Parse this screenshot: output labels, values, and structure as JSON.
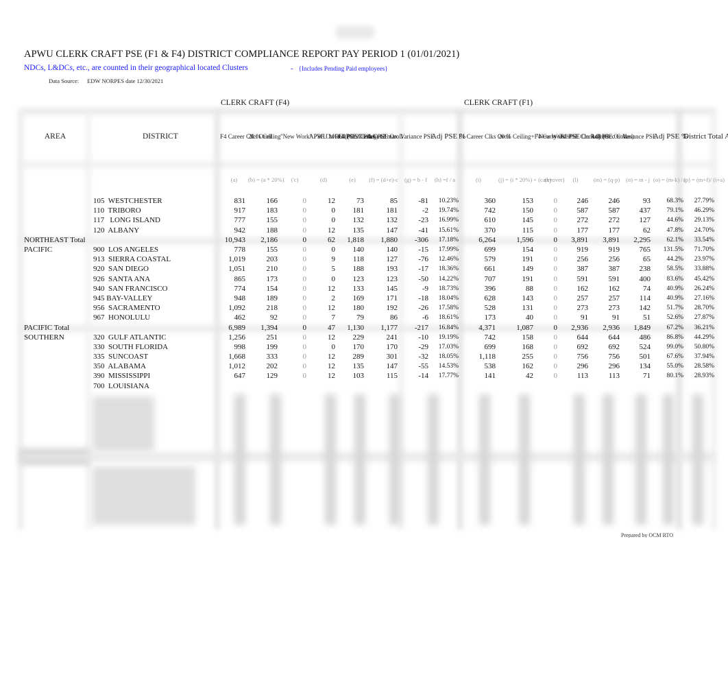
{
  "report": {
    "title": "APWU CLERK CRAFT PSE (F1 & F4) DISTRICT COMPLIANCE REPORT PAY PERIOD 1 (01/01/2021)",
    "subtitle": "NDCs, L&DCs, etc., are counted in their geographical located Clusters",
    "subnote_dash": "-",
    "subnote": "{Includes Pending Paid employees}",
    "data_source_label": "Data Source:",
    "data_source_value": "EDW NORPES date 12/30/2021",
    "prepared_by": "Prepared by OCM RTO"
  },
  "groups": {
    "f4": "CLERK CRAFT (F4)",
    "f1": "CLERK CRAFT (F1)"
  },
  "headers": {
    "area": "AREA",
    "district": "DISTRICT",
    "f4_career": "F4 Career Clks Oroll",
    "f4_ceiling": "20 % Ceiling",
    "f4_new_work": "\"New Work\" PSE On Roll (Occ Codes)",
    "f4_mou": "APWU MOU (POST Plan - 12 max",
    "f4_pse": "F4 PSE Clerk Oroll",
    "f4_adj": "Adj PSE Oroll",
    "f4_var": "Variance PSE",
    "f4_pct": "Adj PSE %",
    "f1_career": "F1 Career Clks Oroll",
    "f1_ceiling": "20 % Ceiling+F4 Carry Over",
    "f1_new_work": "\"New Work\" PSE On Roll (Occ Codes)",
    "f1_pse": "F1 PSE Clerk Oroll",
    "f1_adj": "Adj PSE Oroll",
    "f1_var": "Variance PSE",
    "f1_pct": "Adj PSE %",
    "district_total": "District Total Adj PSE %"
  },
  "formulas": {
    "a": "(a)",
    "b": "(b) = (a * 20%)",
    "c": "('c)",
    "d": "(d)",
    "e": "(e)",
    "f": "(f) = (d+e)-c",
    "g": "(g) = b - f",
    "h": "(h) =f / a",
    "i": "(i)",
    "j": "(j) = (i * 20%) + (carryover)",
    "k": "(k)",
    "l": "(l)",
    "m": "(m) = (q-p)",
    "n": "(n) = m - j",
    "o": "(o) = (m-k) / i",
    "p": "(p) = (m+f)/ (i+a)"
  },
  "rows": [
    {
      "area": "",
      "district": "105  WESTCHESTER",
      "a": "831",
      "b": "166",
      "c": "0",
      "d": "12",
      "e": "73",
      "f": "85",
      "g": "-81",
      "h": "10.23%",
      "i": "360",
      "j": "153",
      "k": "0",
      "l": "246",
      "m": "246",
      "n": "93",
      "o": "68.3%",
      "p": "27.79%",
      "total": false
    },
    {
      "area": "",
      "district": "110  TRIBORO",
      "a": "917",
      "b": "183",
      "c": "0",
      "d": "0",
      "e": "181",
      "f": "181",
      "g": "-2",
      "h": "19.74%",
      "i": "742",
      "j": "150",
      "k": "0",
      "l": "587",
      "m": "587",
      "n": "437",
      "o": "79.1%",
      "p": "46.29%",
      "total": false
    },
    {
      "area": "",
      "district": "117   LONG ISLAND",
      "a": "777",
      "b": "155",
      "c": "0",
      "d": "0",
      "e": "132",
      "f": "132",
      "g": "-23",
      "h": "16.99%",
      "i": "610",
      "j": "145",
      "k": "0",
      "l": "272",
      "m": "272",
      "n": "127",
      "o": "44.6%",
      "p": "29.13%",
      "total": false
    },
    {
      "area": "",
      "district": "120  ALBANY",
      "a": "942",
      "b": "188",
      "c": "0",
      "d": "12",
      "e": "135",
      "f": "147",
      "g": "-41",
      "h": "15.61%",
      "i": "370",
      "j": "115",
      "k": "0",
      "l": "177",
      "m": "177",
      "n": "62",
      "o": "47.8%",
      "p": "24.70%",
      "total": false
    },
    {
      "area": "NORTHEAST Total",
      "district": "",
      "a": "10,943",
      "b": "2,186",
      "c": "0",
      "d": "62",
      "e": "1,818",
      "f": "1,880",
      "g": "-306",
      "h": "17.18%",
      "i": "6,264",
      "j": "1,596",
      "k": "0",
      "l": "3,891",
      "m": "3,891",
      "n": "2,295",
      "o": "62.1%",
      "p": "33.54%",
      "total": true
    },
    {
      "area": "PACIFIC",
      "district": "900  LOS ANGELES",
      "a": "778",
      "b": "155",
      "c": "0",
      "d": "0",
      "e": "140",
      "f": "140",
      "g": "-15",
      "h": "17.99%",
      "i": "699",
      "j": "154",
      "k": "0",
      "l": "919",
      "m": "919",
      "n": "765",
      "o": "131.5%",
      "p": "71.70%",
      "total": false
    },
    {
      "area": "",
      "district": "913  SIERRA COASTAL",
      "a": "1,019",
      "b": "203",
      "c": "0",
      "d": "9",
      "e": "118",
      "f": "127",
      "g": "-76",
      "h": "12.46%",
      "i": "579",
      "j": "191",
      "k": "0",
      "l": "256",
      "m": "256",
      "n": "65",
      "o": "44.2%",
      "p": "23.97%",
      "total": false
    },
    {
      "area": "",
      "district": "920  SAN DIEGO",
      "a": "1,051",
      "b": "210",
      "c": "0",
      "d": "5",
      "e": "188",
      "f": "193",
      "g": "-17",
      "h": "18.36%",
      "i": "661",
      "j": "149",
      "k": "0",
      "l": "387",
      "m": "387",
      "n": "238",
      "o": "58.5%",
      "p": "33.88%",
      "total": false
    },
    {
      "area": "",
      "district": "926  SANTA ANA",
      "a": "865",
      "b": "173",
      "c": "0",
      "d": "0",
      "e": "123",
      "f": "123",
      "g": "-50",
      "h": "14.22%",
      "i": "707",
      "j": "191",
      "k": "0",
      "l": "591",
      "m": "591",
      "n": "400",
      "o": "83.6%",
      "p": "45.42%",
      "total": false
    },
    {
      "area": "",
      "district": "940  SAN FRANCISCO",
      "a": "774",
      "b": "154",
      "c": "0",
      "d": "12",
      "e": "133",
      "f": "145",
      "g": "-9",
      "h": "18.73%",
      "i": "396",
      "j": "88",
      "k": "0",
      "l": "162",
      "m": "162",
      "n": "74",
      "o": "40.9%",
      "p": "26.24%",
      "total": false
    },
    {
      "area": "",
      "district": "945 BAY-VALLEY",
      "a": "948",
      "b": "189",
      "c": "0",
      "d": "2",
      "e": "169",
      "f": "171",
      "g": "-18",
      "h": "18.04%",
      "i": "628",
      "j": "143",
      "k": "0",
      "l": "257",
      "m": "257",
      "n": "114",
      "o": "40.9%",
      "p": "27.16%",
      "total": false
    },
    {
      "area": "",
      "district": "956  SACRAMENTO",
      "a": "1,092",
      "b": "218",
      "c": "0",
      "d": "12",
      "e": "180",
      "f": "192",
      "g": "-26",
      "h": "17.58%",
      "i": "528",
      "j": "131",
      "k": "0",
      "l": "273",
      "m": "273",
      "n": "142",
      "o": "51.7%",
      "p": "28.70%",
      "total": false
    },
    {
      "area": "",
      "district": "967  HONOLULU",
      "a": "462",
      "b": "92",
      "c": "0",
      "d": "7",
      "e": "79",
      "f": "86",
      "g": "-6",
      "h": "18.61%",
      "i": "173",
      "j": "40",
      "k": "0",
      "l": "91",
      "m": "91",
      "n": "51",
      "o": "52.6%",
      "p": "27.87%",
      "total": false
    },
    {
      "area": "PACIFIC Total",
      "district": "",
      "a": "6,989",
      "b": "1,394",
      "c": "0",
      "d": "47",
      "e": "1,130",
      "f": "1,177",
      "g": "-217",
      "h": "16.84%",
      "i": "4,371",
      "j": "1,087",
      "k": "0",
      "l": "2,936",
      "m": "2,936",
      "n": "1,849",
      "o": "67.2%",
      "p": "36.21%",
      "total": true
    },
    {
      "area": "SOUTHERN",
      "district": "320  GULF ATLANTIC",
      "a": "1,256",
      "b": "251",
      "c": "0",
      "d": "12",
      "e": "229",
      "f": "241",
      "g": "-10",
      "h": "19.19%",
      "i": "742",
      "j": "158",
      "k": "0",
      "l": "644",
      "m": "644",
      "n": "486",
      "o": "86.8%",
      "p": "44.29%",
      "total": false
    },
    {
      "area": "",
      "district": "330  SOUTH FLORIDA",
      "a": "998",
      "b": "199",
      "c": "0",
      "d": "0",
      "e": "170",
      "f": "170",
      "g": "-29",
      "h": "17.03%",
      "i": "699",
      "j": "168",
      "k": "0",
      "l": "692",
      "m": "692",
      "n": "524",
      "o": "99.0%",
      "p": "50.80%",
      "total": false
    },
    {
      "area": "",
      "district": "335  SUNCOAST",
      "a": "1,668",
      "b": "333",
      "c": "0",
      "d": "12",
      "e": "289",
      "f": "301",
      "g": "-32",
      "h": "18.05%",
      "i": "1,118",
      "j": "255",
      "k": "0",
      "l": "756",
      "m": "756",
      "n": "501",
      "o": "67.6%",
      "p": "37.94%",
      "total": false
    },
    {
      "area": "",
      "district": "350  ALABAMA",
      "a": "1,012",
      "b": "202",
      "c": "0",
      "d": "12",
      "e": "135",
      "f": "147",
      "g": "-55",
      "h": "14.53%",
      "i": "538",
      "j": "162",
      "k": "0",
      "l": "296",
      "m": "296",
      "n": "134",
      "o": "55.0%",
      "p": "28.58%",
      "total": false
    },
    {
      "area": "",
      "district": "390  MISSISSIPPI",
      "a": "647",
      "b": "129",
      "c": "0",
      "d": "12",
      "e": "103",
      "f": "115",
      "g": "-14",
      "h": "17.77%",
      "i": "141",
      "j": "42",
      "k": "0",
      "l": "113",
      "m": "113",
      "n": "71",
      "o": "80.1%",
      "p": "28.93%",
      "total": false
    },
    {
      "area": "",
      "district": "700  LOUISIANA",
      "a": "",
      "b": "",
      "c": "",
      "d": "",
      "e": "",
      "f": "",
      "g": "",
      "h": "",
      "i": "",
      "j": "",
      "k": "",
      "l": "",
      "m": "",
      "n": "",
      "o": "",
      "p": "",
      "total": false
    }
  ]
}
